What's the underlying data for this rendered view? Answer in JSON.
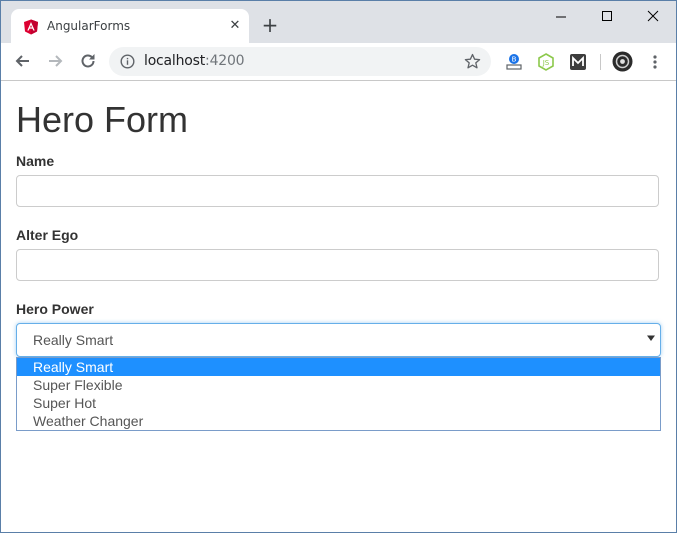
{
  "browser": {
    "tab_title": "AngularForms",
    "tab_close": "✕",
    "new_tab": "+",
    "url_host": "localhost",
    "url_port": ":4200"
  },
  "page": {
    "title": "Hero Form",
    "name_label": "Name",
    "alter_ego_label": "Alter Ego",
    "power_label": "Hero Power",
    "selected_power": "Really Smart",
    "power_options": [
      "Really Smart",
      "Super Flexible",
      "Super Hot",
      "Weather Changer"
    ]
  },
  "colors": {
    "angular_red": "#dd0031",
    "option_highlight": "#1e90ff",
    "focus_border": "#66afe9"
  },
  "icons": {
    "favicon": "angular-logo-icon",
    "back": "arrow-left-icon",
    "forward": "arrow-right-icon",
    "reload": "reload-icon",
    "info": "info-icon",
    "bookmark": "star-icon",
    "ext1": "extension-icon",
    "ext2": "nodejs-extension-icon",
    "ext3": "m-extension-icon",
    "profile": "profile-avatar-icon",
    "menu": "kebab-menu-icon"
  }
}
